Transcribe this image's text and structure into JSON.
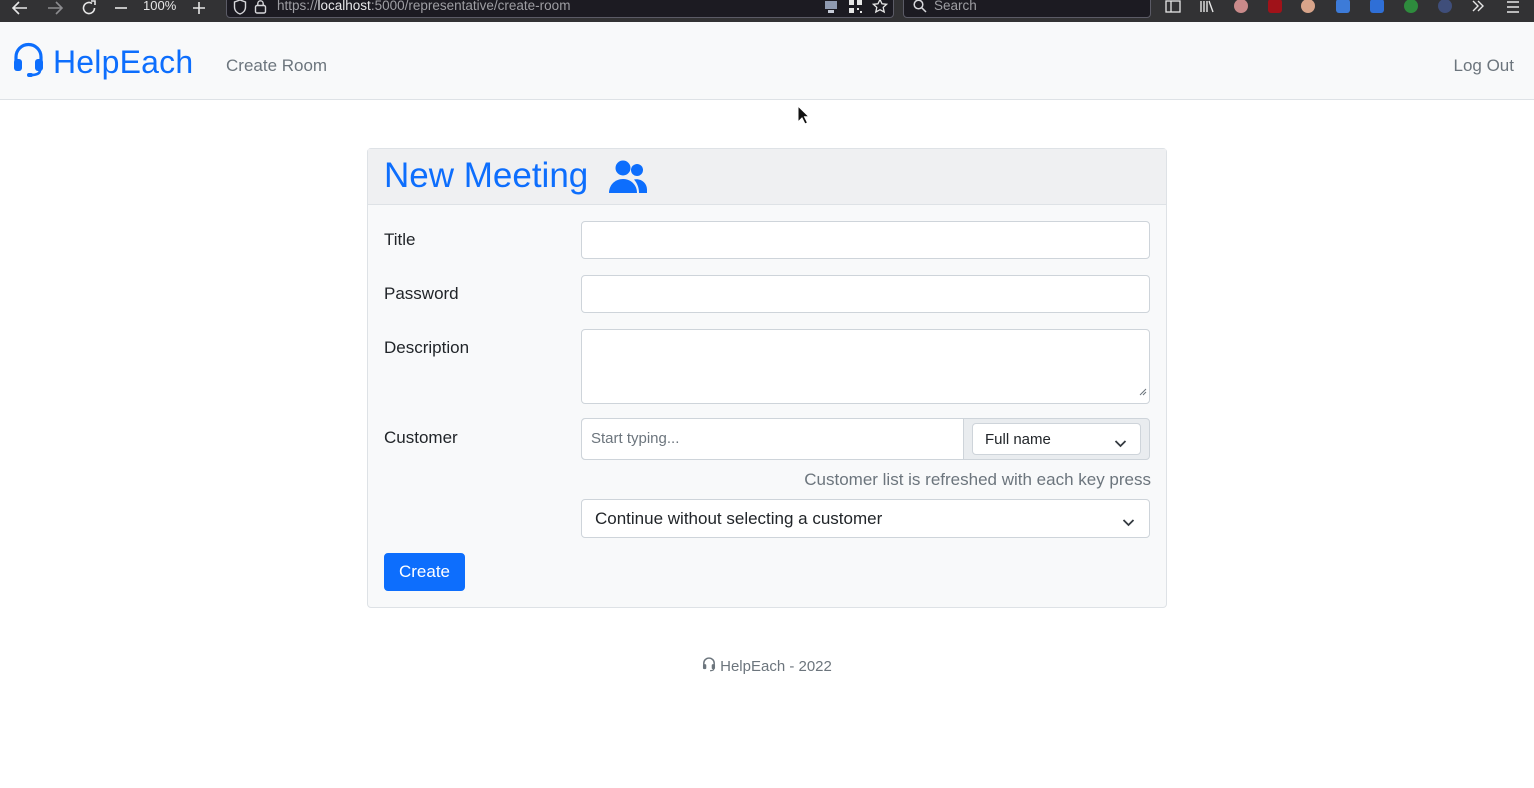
{
  "browser": {
    "zoom": "100%",
    "url_scheme": "https://",
    "url_host": "localhost",
    "url_path": ":5000/representative/create-room",
    "search_placeholder": "Search"
  },
  "navbar": {
    "brand": "HelpEach",
    "create_room": "Create Room",
    "logout": "Log Out"
  },
  "card": {
    "title": "New Meeting",
    "fields": {
      "title_label": "Title",
      "title_value": "",
      "password_label": "Password",
      "password_value": "",
      "description_label": "Description",
      "description_value": "",
      "customer_label": "Customer",
      "customer_placeholder": "Start typing...",
      "customer_search_by": "Full name",
      "customer_help": "Customer list is refreshed with each key press",
      "customer_select": "Continue without selecting a customer"
    },
    "create_button": "Create"
  },
  "footer": {
    "text": "HelpEach - 2022"
  },
  "colors": {
    "primary": "#0d6efd",
    "muted": "#6c757d",
    "navbar_bg": "#f8f9fa"
  }
}
